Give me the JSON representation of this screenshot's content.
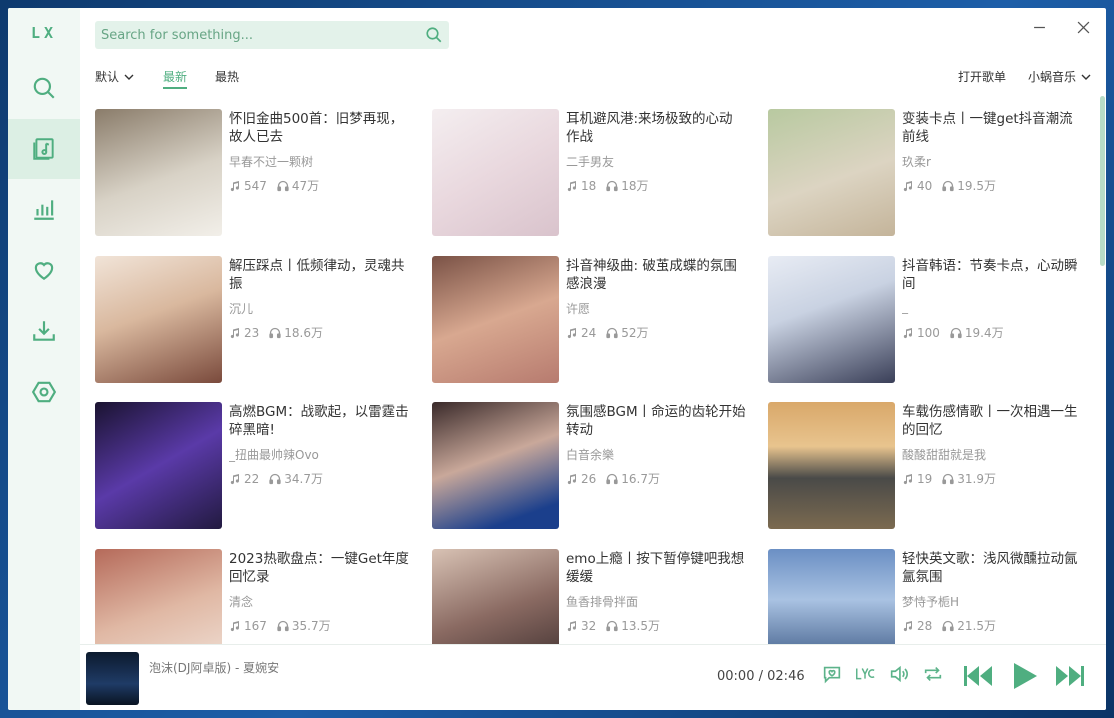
{
  "app": {
    "logo": "LX"
  },
  "search": {
    "placeholder": "Search for something..."
  },
  "tabs": {
    "sort_label": "默认",
    "newest": "最新",
    "hottest": "最热",
    "open_playlist": "打开歌单",
    "source": "小蜗音乐"
  },
  "playlists": [
    {
      "title": "怀旧金曲500首：旧梦再现，故人已去",
      "author": "早春不过一颗树",
      "songs": "547",
      "plays": "47万"
    },
    {
      "title": "耳机避风港:来场极致的心动作战",
      "author": "二手男友",
      "songs": "18",
      "plays": "18万"
    },
    {
      "title": "变装卡点丨一键get抖音潮流前线",
      "author": "玖柔r",
      "songs": "40",
      "plays": "19.5万"
    },
    {
      "title": "解压踩点丨低频律动，灵魂共振",
      "author": "沉儿",
      "songs": "23",
      "plays": "18.6万"
    },
    {
      "title": "抖音神级曲: 破茧成蝶的氛围感浪漫",
      "author": "许愿",
      "songs": "24",
      "plays": "52万"
    },
    {
      "title": "抖音韩语：节奏卡点，心动瞬间",
      "author": "_",
      "songs": "100",
      "plays": "19.4万"
    },
    {
      "title": "高燃BGM：战歌起，以雷霆击碎黑暗!",
      "author": "_扭曲最帅辣Ovo",
      "songs": "22",
      "plays": "34.7万"
    },
    {
      "title": "氛围感BGM丨命运的齿轮开始转动",
      "author": "白音余樂",
      "songs": "26",
      "plays": "16.7万"
    },
    {
      "title": "车载伤感情歌丨一次相遇一生的回忆",
      "author": "酸酸甜甜就是我",
      "songs": "19",
      "plays": "31.9万"
    },
    {
      "title": "2023热歌盘点：一键Get年度回忆录",
      "author": "清念",
      "songs": "167",
      "plays": "35.7万"
    },
    {
      "title": "emo上瘾丨按下暂停键吧我想缓缓",
      "author": "鱼香排骨拌面",
      "songs": "32",
      "plays": "13.5万"
    },
    {
      "title": "轻快英文歌：浅风微醺拉动氤氲氛围",
      "author": "梦恃予栀H",
      "songs": "28",
      "plays": "21.5万"
    }
  ],
  "player": {
    "song": "泡沫(DJ阿卓版) - 夏婉安",
    "current": "00:00",
    "sep": "/",
    "total": "02:46"
  },
  "colors": {
    "accent": "#4fae80",
    "sidebar_bg": "#f1f8f4",
    "active_bg": "#dcefe4"
  }
}
